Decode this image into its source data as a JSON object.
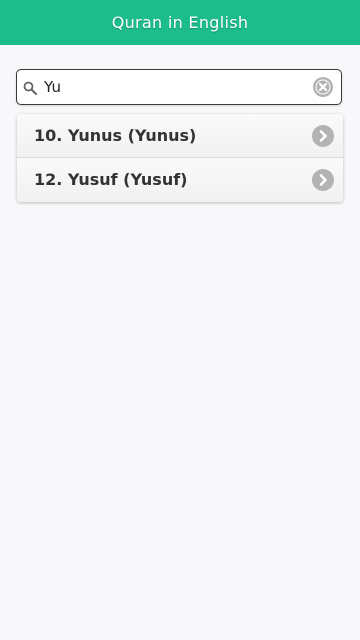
{
  "header": {
    "title": "Quran in English"
  },
  "search": {
    "value": "Yu",
    "placeholder": ""
  },
  "results": [
    {
      "label": "10. Yunus (Yunus)"
    },
    {
      "label": "12. Yusuf (Yusuf)"
    }
  ],
  "colors": {
    "header_bg": "#1dbd8b",
    "page_bg": "#f8f8fa",
    "icon_gray": "#b3b3b3"
  },
  "icons": {
    "search": "search-icon",
    "clear": "clear-icon",
    "chevron": "chevron-right-icon"
  }
}
